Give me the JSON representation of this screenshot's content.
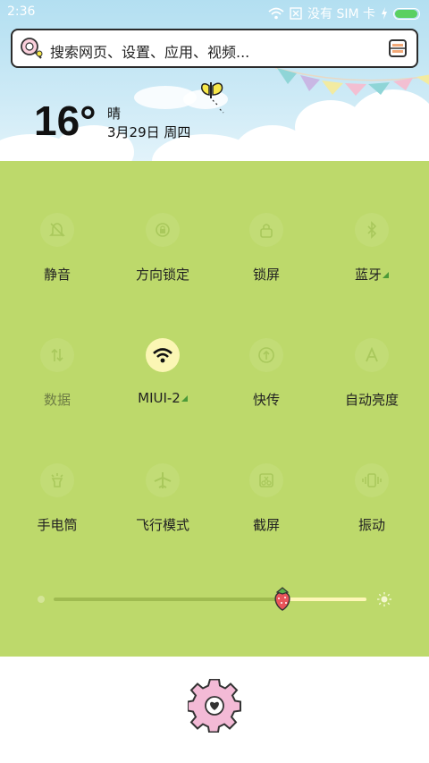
{
  "status_bar": {
    "time": "2:36",
    "carrier": "没有 SIM 卡",
    "icons": [
      "wifi-icon",
      "sim-icon",
      "charging-icon",
      "battery-icon"
    ],
    "battery_level_percent": 95
  },
  "search": {
    "placeholder": "搜索网页、设置、应用、视频...",
    "left_icon": "lollipop-icon",
    "right_icon": "scan-icon"
  },
  "weather": {
    "temperature": "16°",
    "condition": "晴",
    "date": "3月29日 周四"
  },
  "toggles": [
    {
      "label": "静音",
      "icon": "bell-off-icon",
      "active": false,
      "has_more": false,
      "muted": false
    },
    {
      "label": "方向锁定",
      "icon": "rotation-lock-icon",
      "active": false,
      "has_more": false,
      "muted": false
    },
    {
      "label": "锁屏",
      "icon": "lock-icon",
      "active": false,
      "has_more": false,
      "muted": false
    },
    {
      "label": "蓝牙",
      "icon": "bluetooth-icon",
      "active": false,
      "has_more": true,
      "muted": false
    },
    {
      "label": "数据",
      "icon": "mobile-data-icon",
      "active": false,
      "has_more": false,
      "muted": true
    },
    {
      "label": "MIUI-2",
      "icon": "wifi-icon",
      "active": true,
      "has_more": true,
      "muted": false
    },
    {
      "label": "快传",
      "icon": "share-icon",
      "active": false,
      "has_more": false,
      "muted": false
    },
    {
      "label": "自动亮度",
      "icon": "auto-brightness-icon",
      "active": false,
      "has_more": false,
      "muted": false
    },
    {
      "label": "手电筒",
      "icon": "flashlight-icon",
      "active": false,
      "has_more": false,
      "muted": false
    },
    {
      "label": "飞行模式",
      "icon": "airplane-icon",
      "active": false,
      "has_more": false,
      "muted": false
    },
    {
      "label": "截屏",
      "icon": "screenshot-icon",
      "active": false,
      "has_more": false,
      "muted": false
    },
    {
      "label": "振动",
      "icon": "vibrate-icon",
      "active": false,
      "has_more": false,
      "muted": false
    }
  ],
  "brightness": {
    "level_fraction": 0.73,
    "low_icon": "dim-dot-icon",
    "high_icon": "sun-icon",
    "thumb_icon": "strawberry-icon"
  },
  "footer": {
    "settings_icon": "settings-gear-icon"
  },
  "colors": {
    "panel": "#bdd96b",
    "active_toggle": "#fbf6b4",
    "sky": "#b3dff1"
  }
}
